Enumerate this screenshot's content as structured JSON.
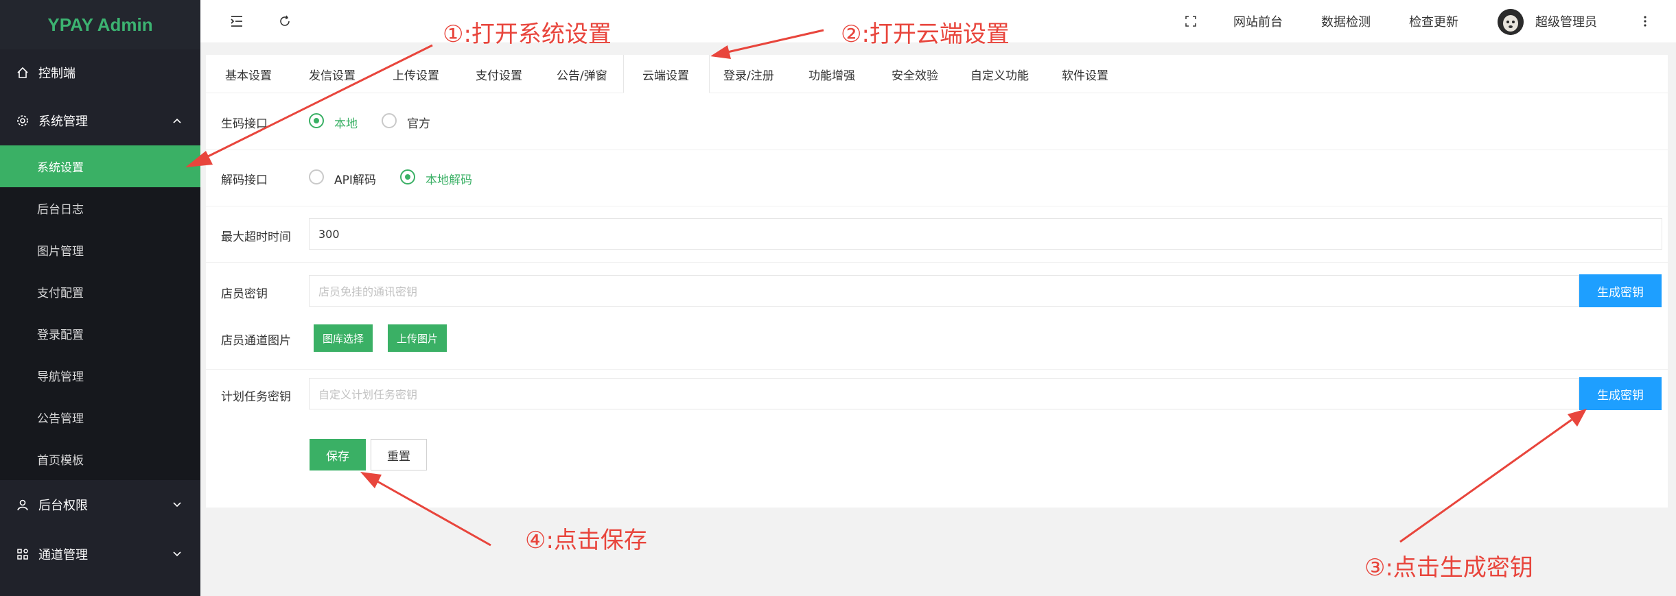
{
  "sidebar": {
    "logo": "YPAY Admin",
    "items": [
      {
        "label": "控制端",
        "icon": "home-icon"
      },
      {
        "label": "系统管理",
        "icon": "gear-icon"
      }
    ],
    "submenu": [
      "系统设置",
      "后台日志",
      "图片管理",
      "支付配置",
      "登录配置",
      "导航管理",
      "公告管理",
      "首页模板"
    ],
    "bottom_items": [
      {
        "label": "后台权限",
        "icon": "user-icon"
      },
      {
        "label": "通道管理",
        "icon": "apps-icon"
      }
    ]
  },
  "topbar": {
    "links": [
      "网站前台",
      "数据检测",
      "检查更新"
    ],
    "user": "超级管理员"
  },
  "tabs": [
    "基本设置",
    "发信设置",
    "上传设置",
    "支付设置",
    "公告/弹窗",
    "云端设置",
    "登录/注册",
    "功能增强",
    "安全效验",
    "自定义功能",
    "软件设置"
  ],
  "form": {
    "code_api": {
      "label": "生码接口",
      "opt1": "本地",
      "opt2": "官方"
    },
    "decode_api": {
      "label": "解码接口",
      "opt1": "API解码",
      "opt2": "本地解码"
    },
    "timeout": {
      "label": "最大超时时间",
      "value": "300"
    },
    "clerk_key": {
      "label": "店员密钥",
      "placeholder": "店员免挂的通讯密钥",
      "button": "生成密钥"
    },
    "clerk_img": {
      "label": "店员通道图片",
      "btn1": "图库选择",
      "btn2": "上传图片"
    },
    "cron_key": {
      "label": "计划任务密钥",
      "placeholder": "自定义计划任务密钥",
      "button": "生成密钥"
    },
    "save": "保存",
    "reset": "重置"
  },
  "annotations": {
    "a1": "①:打开系统设置",
    "a2": "②:打开云端设置",
    "a3": "③:点击生成密钥",
    "a4": "④:点击保存"
  },
  "colors": {
    "accent": "#3ab065",
    "blue": "#1e9fff",
    "annotation": "#e8453c",
    "sidebar": "#20222a"
  }
}
